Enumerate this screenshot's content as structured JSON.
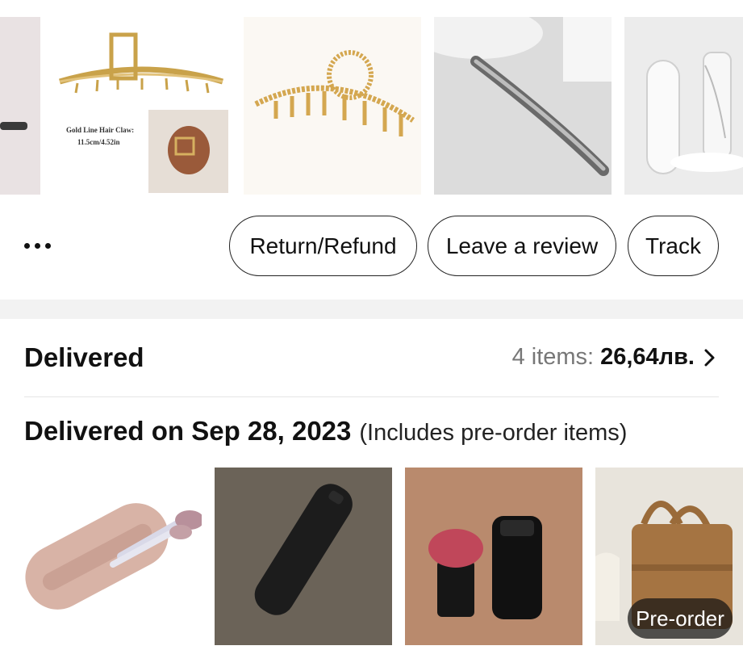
{
  "actions": {
    "more_label": "more-options-icon",
    "return_refund": "Return/Refund",
    "leave_review": "Leave a review",
    "track": "Track"
  },
  "order": {
    "status": "Delivered",
    "items_label": "4 items:",
    "total": "26,64лв.",
    "delivered_on": "Delivered on Sep 28, 2023",
    "delivered_note": "(Includes pre-order items)"
  },
  "top_thumbnails": [
    {
      "name": "partial-product",
      "caption": ""
    },
    {
      "name": "gold-line-hair-claw",
      "caption_line1": "Gold Line Hair Claw:",
      "caption_line2": "11.5cm/4.52in"
    },
    {
      "name": "gold-rhinestone-hair-claw"
    },
    {
      "name": "silver-hair-clip"
    },
    {
      "name": "white-umbrella-capsule"
    }
  ],
  "bottom_thumbnails": [
    {
      "name": "pink-silicone-brush-case"
    },
    {
      "name": "black-silicone-case"
    },
    {
      "name": "makeup-sponge-holder"
    },
    {
      "name": "brown-canvas-bag",
      "badge": "Pre-order"
    }
  ],
  "colors": {
    "border": "#222222",
    "muted_text": "#777777",
    "band": "#f2f2f2"
  }
}
